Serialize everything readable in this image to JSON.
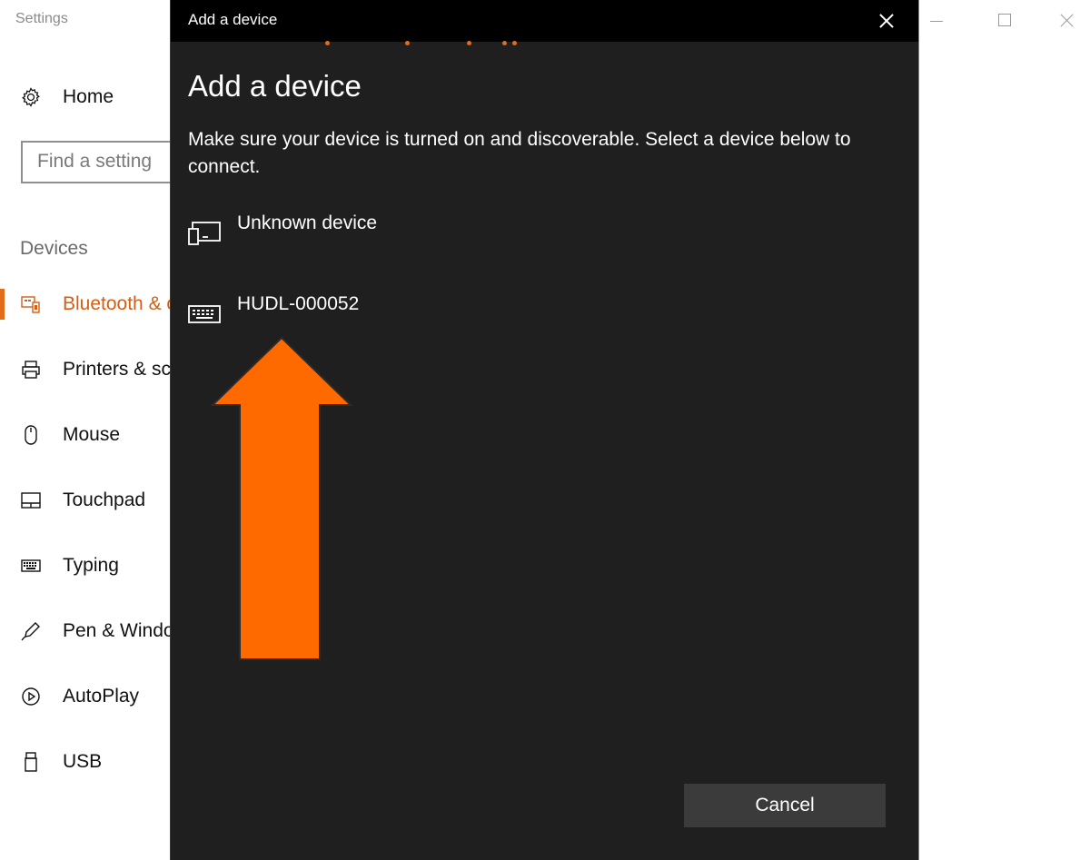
{
  "window": {
    "title": "Settings"
  },
  "sidebar": {
    "home_label": "Home",
    "search_placeholder": "Find a setting",
    "section_label": "Devices",
    "items": [
      {
        "label": "Bluetooth & other devices",
        "icon": "bluetooth-devices-icon",
        "active": true
      },
      {
        "label": "Printers & scanners",
        "icon": "printer-icon",
        "active": false
      },
      {
        "label": "Mouse",
        "icon": "mouse-icon",
        "active": false
      },
      {
        "label": "Touchpad",
        "icon": "touchpad-icon",
        "active": false
      },
      {
        "label": "Typing",
        "icon": "keyboard-icon",
        "active": false
      },
      {
        "label": "Pen & Windows Ink",
        "icon": "pen-icon",
        "active": false
      },
      {
        "label": "AutoPlay",
        "icon": "autoplay-icon",
        "active": false
      },
      {
        "label": "USB",
        "icon": "usb-icon",
        "active": false
      }
    ]
  },
  "dialog": {
    "titlebar": "Add a device",
    "heading": "Add a device",
    "instructions": "Make sure your device is turned on and discoverable. Select a device below to connect.",
    "devices": [
      {
        "label": "Unknown device",
        "icon": "generic-device-icon"
      },
      {
        "label": "HUDL-000052",
        "icon": "keyboard-device-icon"
      }
    ],
    "cancel_label": "Cancel"
  },
  "colors": {
    "accent": "#e36b1a",
    "dialog_bg": "#1f1f1f",
    "arrow": "#ff6a00"
  }
}
